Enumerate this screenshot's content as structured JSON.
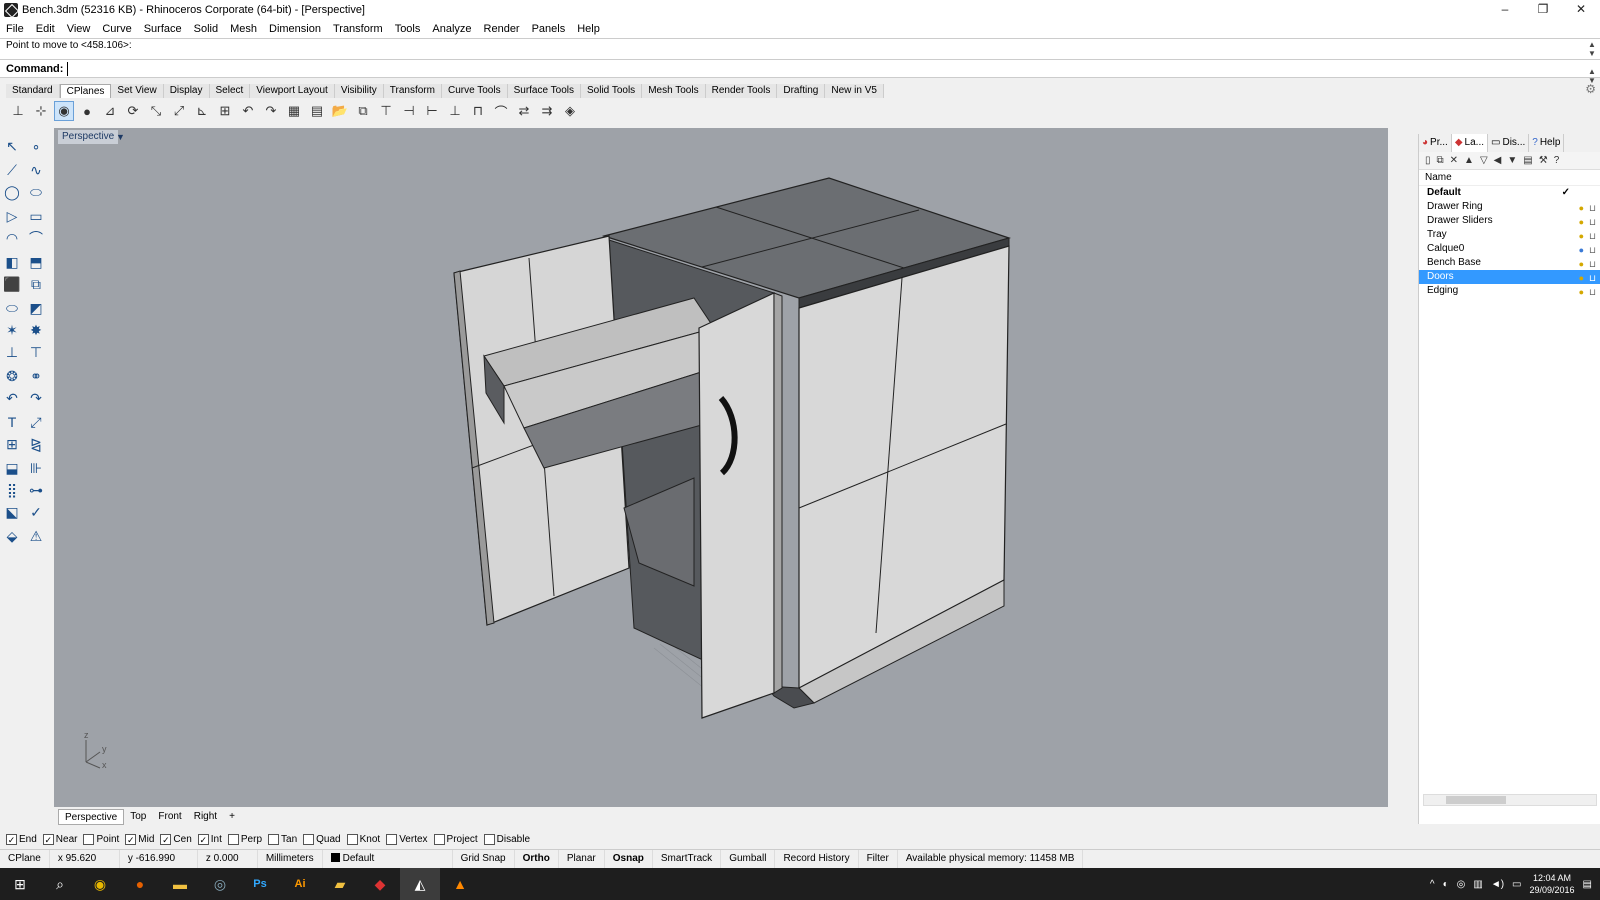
{
  "window": {
    "title": "Bench.3dm (52316 KB) - Rhinoceros Corporate (64-bit) - [Perspective]",
    "controls": [
      "–",
      "❐",
      "✕"
    ]
  },
  "menu": [
    "File",
    "Edit",
    "View",
    "Curve",
    "Surface",
    "Solid",
    "Mesh",
    "Dimension",
    "Transform",
    "Tools",
    "Analyze",
    "Render",
    "Panels",
    "Help"
  ],
  "command": {
    "history": "Point to move to <458.106>:",
    "label": "Command:",
    "value": ""
  },
  "toolbar_tabs": [
    "Standard",
    "CPlanes",
    "Set View",
    "Display",
    "Select",
    "Viewport Layout",
    "Visibility",
    "Transform",
    "Curve Tools",
    "Surface Tools",
    "Solid Tools",
    "Mesh Tools",
    "Render Tools",
    "Drafting",
    "New in V5"
  ],
  "active_toolbar_tab": "CPlanes",
  "viewport": {
    "label": "Perspective",
    "axis_x": "x",
    "axis_y": "y",
    "axis_z": "z"
  },
  "view_tabs": [
    "Perspective",
    "Top",
    "Front",
    "Right",
    "+"
  ],
  "osnaps": [
    {
      "label": "End",
      "checked": true
    },
    {
      "label": "Near",
      "checked": true
    },
    {
      "label": "Point",
      "checked": false
    },
    {
      "label": "Mid",
      "checked": true
    },
    {
      "label": "Cen",
      "checked": true
    },
    {
      "label": "Int",
      "checked": true
    },
    {
      "label": "Perp",
      "checked": false
    },
    {
      "label": "Tan",
      "checked": false
    },
    {
      "label": "Quad",
      "checked": false
    },
    {
      "label": "Knot",
      "checked": false
    },
    {
      "label": "Vertex",
      "checked": false
    },
    {
      "label": "Project",
      "checked": false
    },
    {
      "label": "Disable",
      "checked": false
    }
  ],
  "status": {
    "cplane": "CPlane",
    "x": "x 95.620",
    "y": "y -616.990",
    "z": "z 0.000",
    "units": "Millimeters",
    "layer": "Default",
    "grid_snap": "Grid Snap",
    "ortho": "Ortho",
    "planar": "Planar",
    "osnap": "Osnap",
    "smarttrack": "SmartTrack",
    "gumball": "Gumball",
    "record_history": "Record History",
    "filter": "Filter",
    "memory": "Available physical memory: 11458 MB"
  },
  "panel": {
    "tabs": [
      "Pr...",
      "La...",
      "Dis...",
      "Help"
    ],
    "header": "Name",
    "layers": [
      {
        "name": "Default",
        "current": true
      },
      {
        "name": "Drawer Ring"
      },
      {
        "name": "Drawer Sliders"
      },
      {
        "name": "Tray"
      },
      {
        "name": "Calque0"
      },
      {
        "name": "Bench Base"
      },
      {
        "name": "Doors",
        "selected": true
      },
      {
        "name": "Edging"
      }
    ],
    "current_mark": "✓"
  },
  "clock": {
    "time": "12:04 AM",
    "date": "29/09/2016"
  },
  "taskbar_icons": [
    "windows-start-icon",
    "search-icon",
    "chrome-icon",
    "firefox-icon",
    "file-explorer-icon",
    "steam-icon",
    "photoshop-icon",
    "illustrator-icon",
    "folder-icon",
    "app-red-icon",
    "rhino-icon",
    "vlc-icon"
  ],
  "taskbar_labels": {
    "photoshop": "Ps",
    "illustrator": "Ai"
  }
}
